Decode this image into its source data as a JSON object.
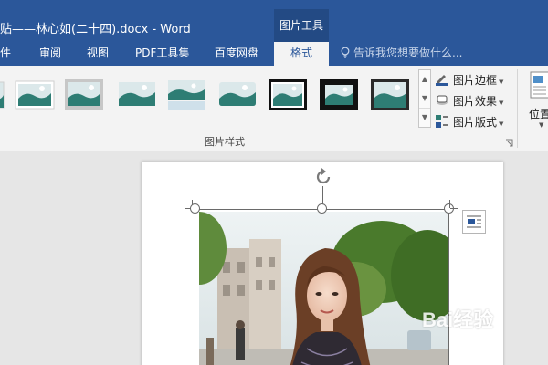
{
  "window": {
    "title": "贴——林心如(二十四).docx - Word",
    "contextual_tab_group": "图片工具"
  },
  "tabs": [
    {
      "label": "件"
    },
    {
      "label": "审阅"
    },
    {
      "label": "视图"
    },
    {
      "label": "PDF工具集"
    },
    {
      "label": "百度网盘"
    },
    {
      "label": "格式",
      "active": true
    }
  ],
  "tell_me": {
    "placeholder": "告诉我您想要做什么...",
    "icon": "lightbulb-icon"
  },
  "ribbon": {
    "picture_styles_label": "图片样式",
    "picture_commands": [
      {
        "label": "图片边框",
        "icon": "pencil-border-icon"
      },
      {
        "label": "图片效果",
        "icon": "effects-icon"
      },
      {
        "label": "图片版式",
        "icon": "smartart-layout-icon"
      }
    ],
    "position_label": "位置"
  },
  "watermark": "Bai经验"
}
